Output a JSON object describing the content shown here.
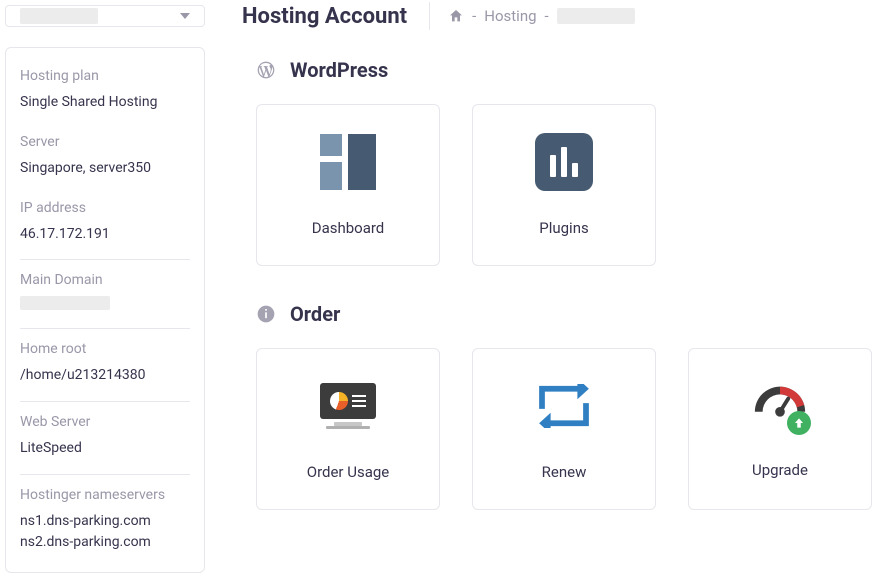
{
  "header": {
    "title": "Hosting Account",
    "breadcrumbs": {
      "hosting": "Hosting",
      "sep": "-"
    }
  },
  "sidebar": {
    "info": [
      {
        "label": "Hosting plan",
        "value": "Single Shared Hosting",
        "bordered": false
      },
      {
        "label": "Server",
        "value": "Singapore, server350",
        "bordered": false
      },
      {
        "label": "IP address",
        "value": "46.17.172.191",
        "bordered": true
      },
      {
        "label": "Main Domain",
        "value": "",
        "redacted": true,
        "bordered": true
      },
      {
        "label": "Home root",
        "value": "/home/u213214380",
        "bordered": true
      },
      {
        "label": "Web Server",
        "value": "LiteSpeed",
        "bordered": true
      },
      {
        "label": "Hostinger nameservers",
        "value": "ns1.dns-parking.com\nns2.dns-parking.com",
        "bordered": false
      }
    ]
  },
  "sections": {
    "wordpress": {
      "title": "WordPress",
      "cards": [
        {
          "name": "dashboard",
          "label": "Dashboard"
        },
        {
          "name": "plugins",
          "label": "Plugins"
        }
      ]
    },
    "order": {
      "title": "Order",
      "cards": [
        {
          "name": "order-usage",
          "label": "Order Usage"
        },
        {
          "name": "renew",
          "label": "Renew"
        },
        {
          "name": "upgrade",
          "label": "Upgrade"
        }
      ]
    }
  }
}
